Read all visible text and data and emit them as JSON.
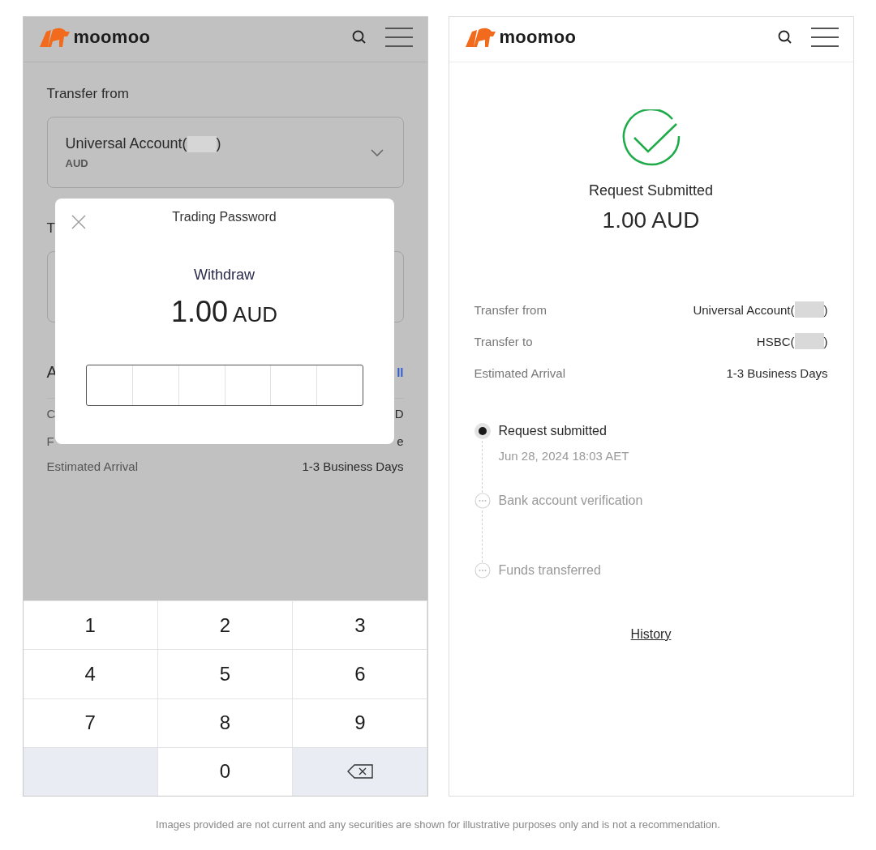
{
  "left": {
    "header": {
      "logo": "moomoo"
    },
    "transfer_from_label": "Transfer from",
    "source": {
      "name_prefix": "Universal Account(",
      "redacted": true,
      "name_suffix": ")",
      "currency": "AUD"
    },
    "covered": {
      "section_2_label": "T",
      "section_3_label": "A",
      "section_3_link": "ll",
      "rows": [
        {
          "left": "C",
          "right": "D"
        },
        {
          "left": "F",
          "right": "e"
        }
      ]
    },
    "estimated_arrival": {
      "label": "Estimated Arrival",
      "value": "1-3 Business Days"
    },
    "dialog": {
      "title": "Trading Password",
      "action": "Withdraw",
      "amount": "1.00",
      "currency": "AUD",
      "cells": [
        {
          "filled": false
        },
        {
          "filled": false
        },
        {
          "filled": false
        },
        {
          "filled": false
        },
        {
          "filled": false
        },
        {
          "filled": false
        }
      ]
    },
    "keypad": [
      {
        "kind": "digit",
        "label": "1"
      },
      {
        "kind": "digit",
        "label": "2"
      },
      {
        "kind": "digit",
        "label": "3"
      },
      {
        "kind": "digit",
        "label": "4"
      },
      {
        "kind": "digit",
        "label": "5"
      },
      {
        "kind": "digit",
        "label": "6"
      },
      {
        "kind": "digit",
        "label": "7"
      },
      {
        "kind": "digit",
        "label": "8"
      },
      {
        "kind": "digit",
        "label": "9"
      },
      {
        "kind": "blank"
      },
      {
        "kind": "digit",
        "label": "0"
      },
      {
        "kind": "backspace"
      }
    ]
  },
  "right": {
    "header": {
      "logo": "moomoo"
    },
    "status": {
      "kind": "success",
      "title": "Request Submitted",
      "amount": "1.00 AUD"
    },
    "details": [
      {
        "label": "Transfer from",
        "value_prefix": "Universal Account(",
        "redacted": true,
        "value_suffix": ")"
      },
      {
        "label": "Transfer to",
        "value_prefix": "HSBC(",
        "redacted": true,
        "value_suffix": ")"
      },
      {
        "label": "Estimated Arrival",
        "value_prefix": "1-3 Business Days",
        "redacted": false
      }
    ],
    "timeline": [
      {
        "label": "Request submitted",
        "time": "Jun 28, 2024 18:03 AET",
        "done": true
      },
      {
        "label": "Bank account verification",
        "done": false
      },
      {
        "label": "Funds transferred",
        "done": false
      }
    ],
    "history_link": "History"
  },
  "footer": "Images provided are not current and any securities are shown for illustrative purposes only and is not a recommendation."
}
